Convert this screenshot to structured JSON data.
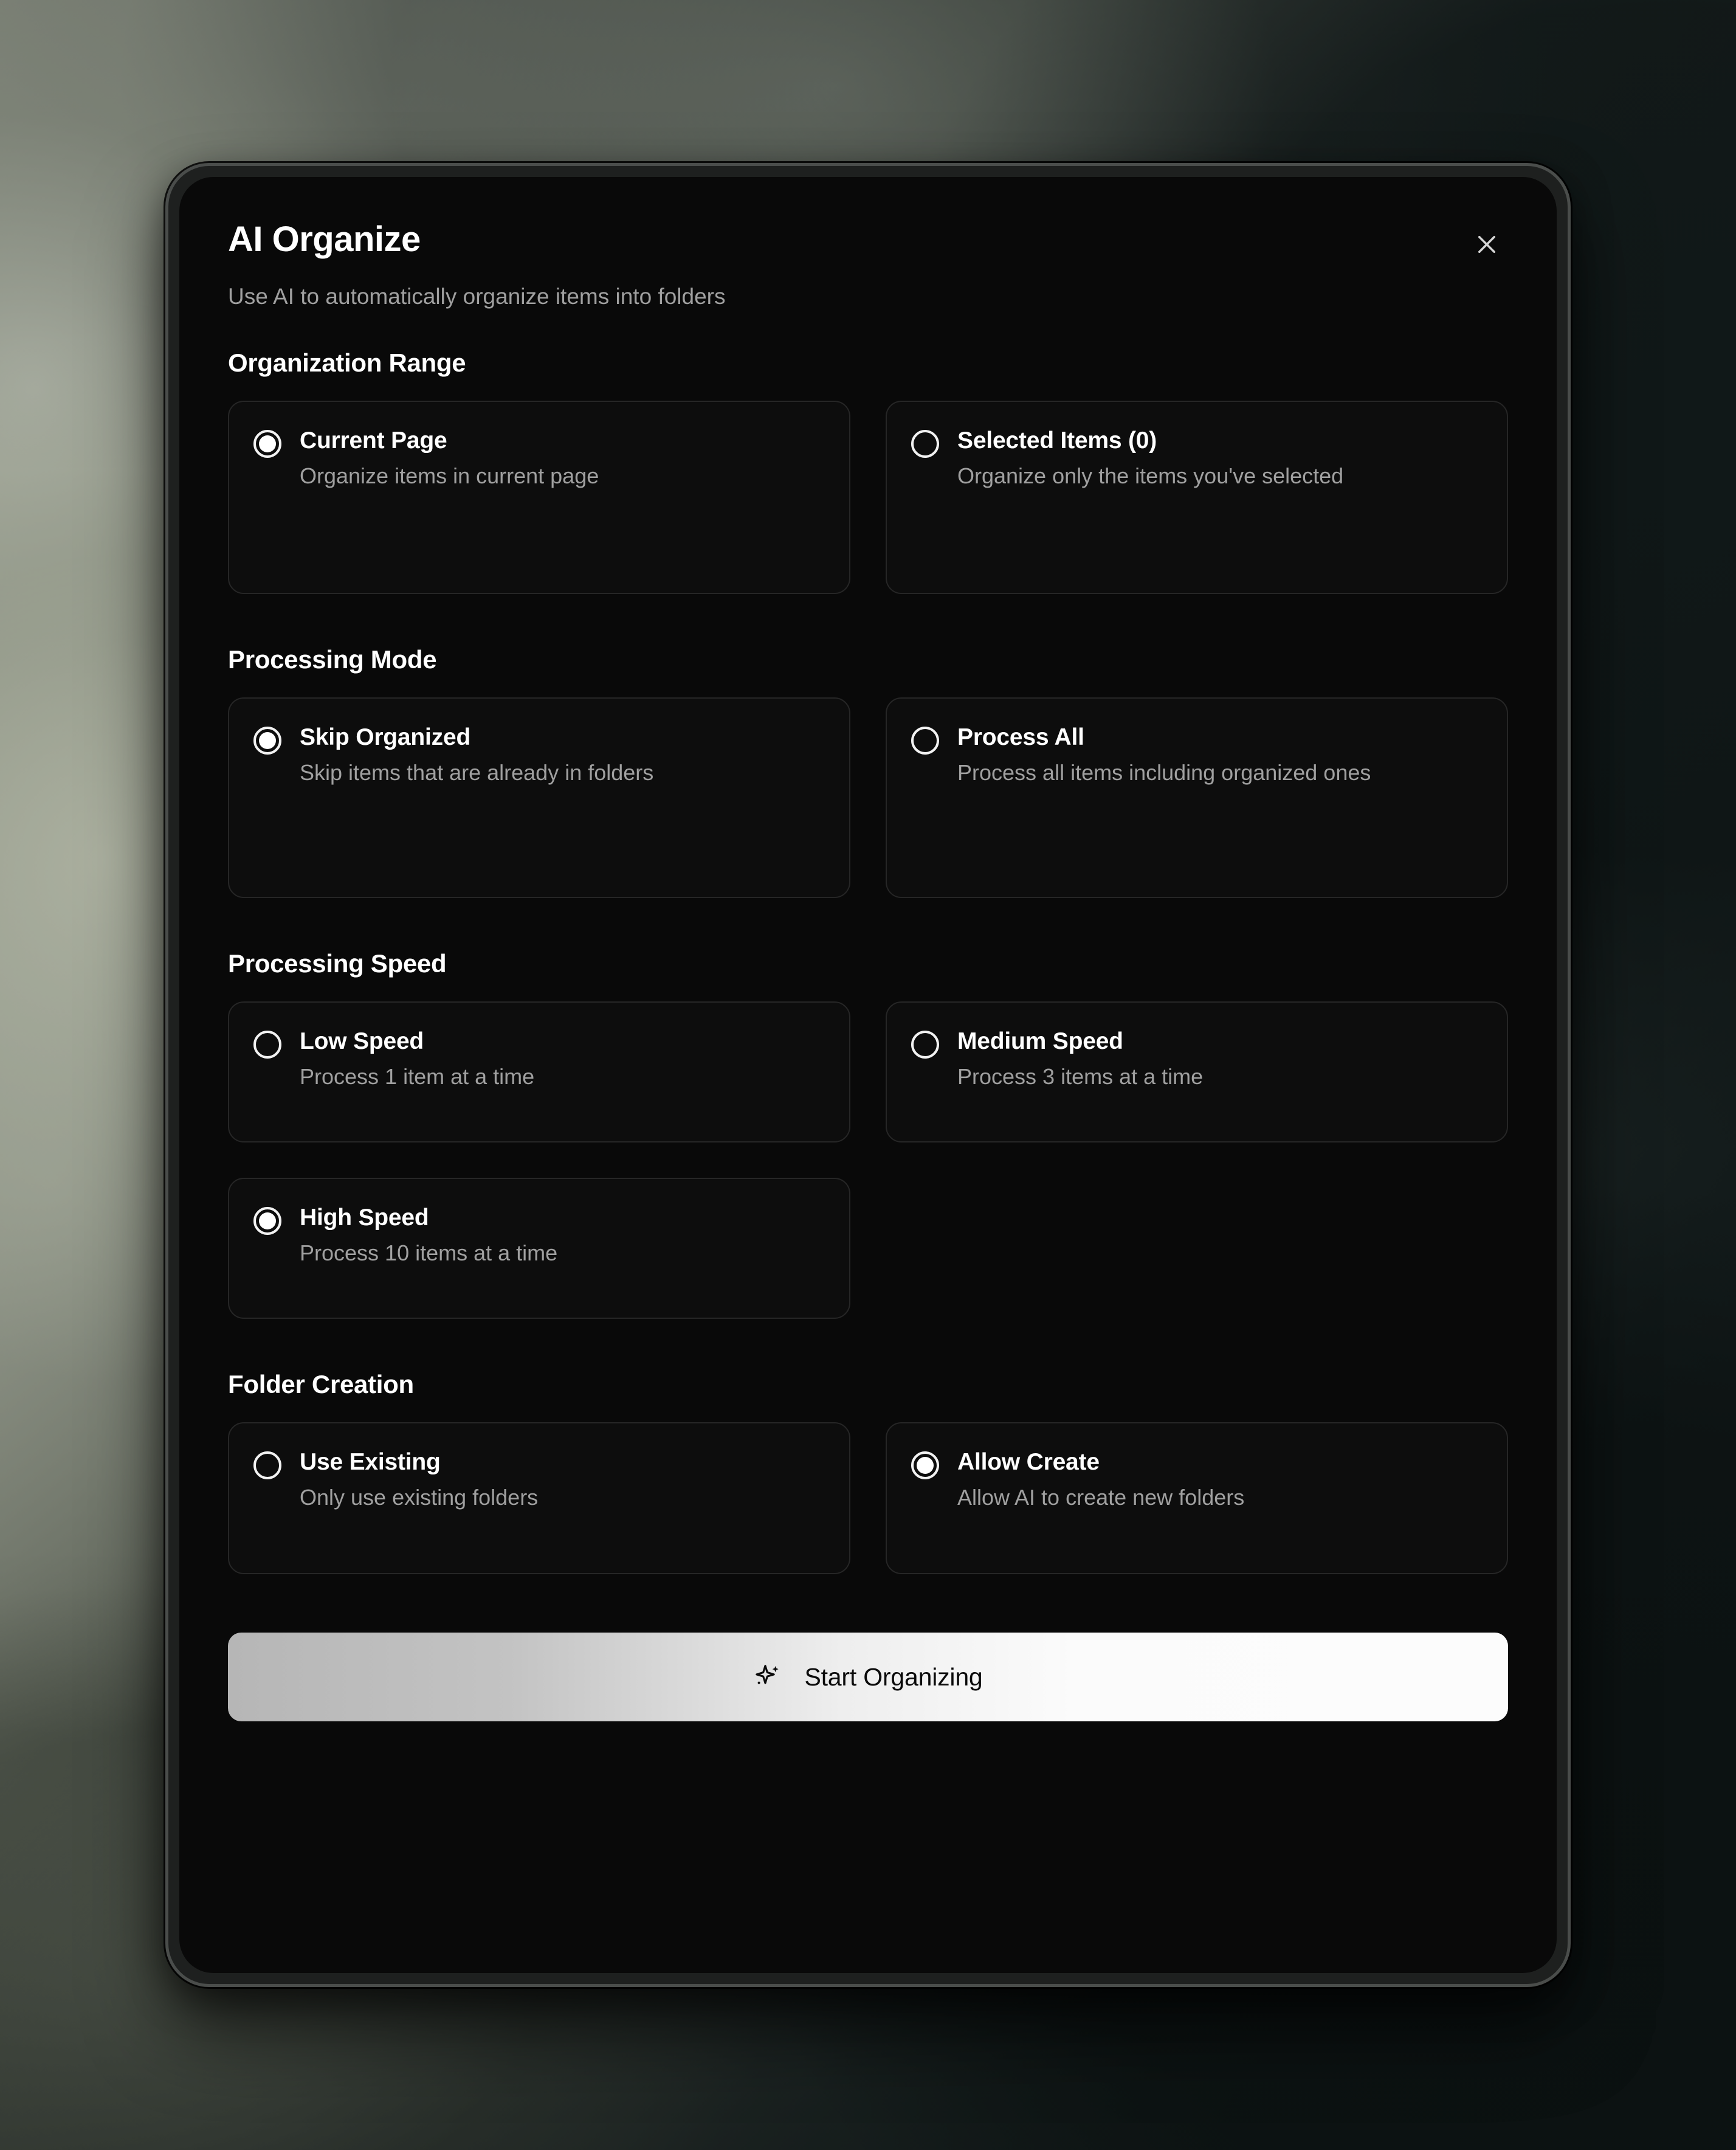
{
  "modal": {
    "title": "AI Organize",
    "subtitle": "Use AI to automatically organize items into folders",
    "close_icon": "close-icon"
  },
  "sections": [
    {
      "heading": "Organization Range",
      "options": [
        {
          "label": "Current Page",
          "description": "Organize items in current page",
          "selected": true
        },
        {
          "label": "Selected Items (0)",
          "description": "Organize only the items you've selected",
          "selected": false
        }
      ]
    },
    {
      "heading": "Processing Mode",
      "options": [
        {
          "label": "Skip Organized",
          "description": "Skip items that are already in folders",
          "selected": true
        },
        {
          "label": "Process All",
          "description": "Process all items including organized ones",
          "selected": false
        }
      ]
    },
    {
      "heading": "Processing Speed",
      "options": [
        {
          "label": "Low Speed",
          "description": "Process 1 item at a time",
          "selected": false
        },
        {
          "label": "Medium Speed",
          "description": "Process 3 items at a time",
          "selected": false
        },
        {
          "label": "High Speed",
          "description": "Process 10 items at a time",
          "selected": true
        }
      ]
    },
    {
      "heading": "Folder Creation",
      "options": [
        {
          "label": "Use Existing",
          "description": "Only use existing folders",
          "selected": false
        },
        {
          "label": "Allow Create",
          "description": "Allow AI to create new folders",
          "selected": true
        }
      ]
    }
  ],
  "footer": {
    "start_button_label": "Start Organizing",
    "start_button_icon": "sparkle-icon"
  },
  "colors": {
    "modal_background": "#090909",
    "card_background": "#0d0d0d",
    "card_border": "#262626",
    "text_primary": "#ffffff",
    "text_secondary": "#a0a0a0",
    "accent_button_start": "#b6b6b6",
    "accent_button_end": "#fcfcfc",
    "device_frame": "#1e201f"
  }
}
